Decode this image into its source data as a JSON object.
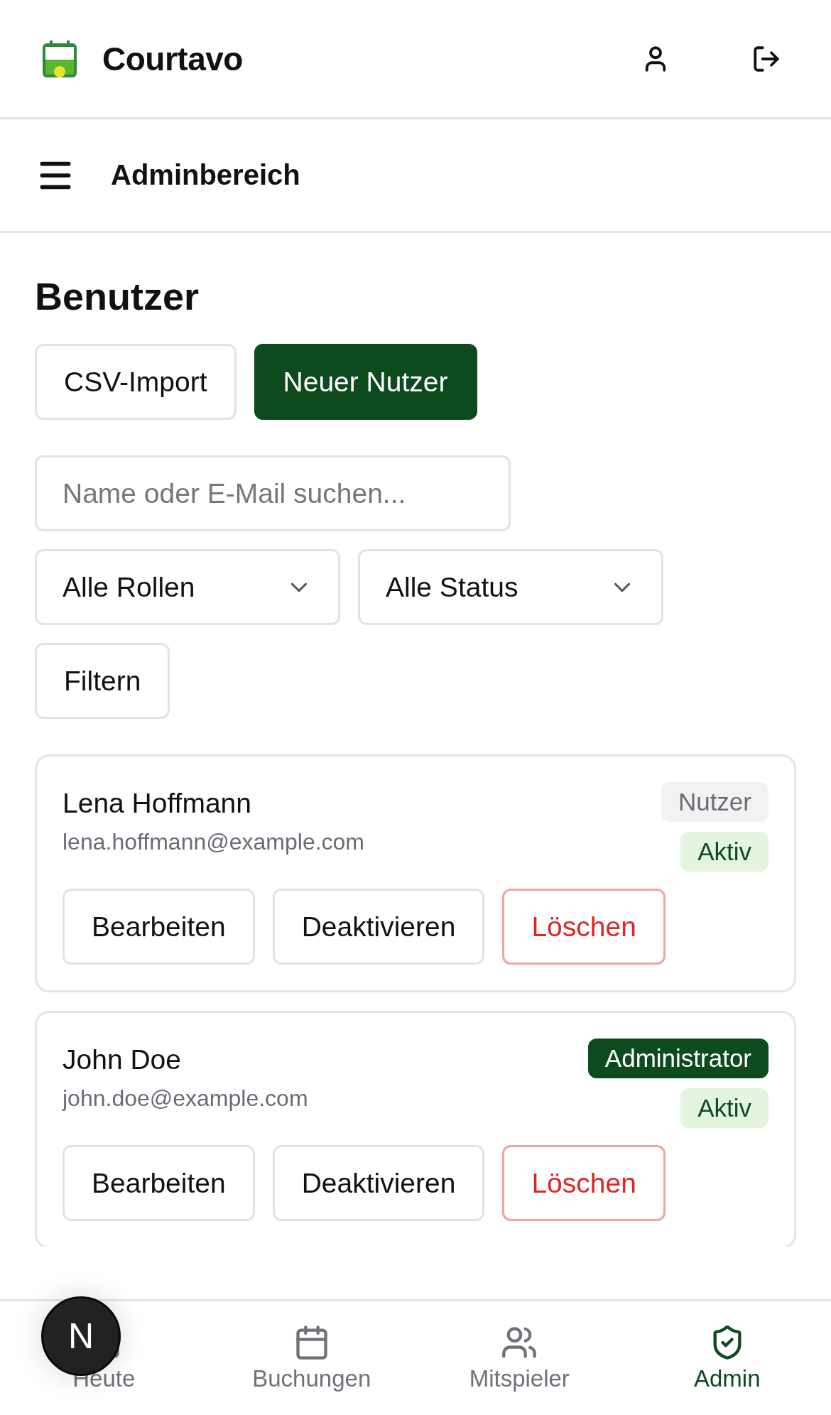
{
  "header": {
    "brand": "Courtavo"
  },
  "subbar": {
    "title": "Adminbereich"
  },
  "page": {
    "title": "Benutzer",
    "actions": [
      {
        "label": "CSV-Import",
        "kind": "secondary"
      },
      {
        "label": "Neuer Nutzer",
        "kind": "primary"
      }
    ],
    "search": {
      "placeholder": "Name oder E-Mail suchen..."
    },
    "filters": [
      {
        "value": "Alle Rollen"
      },
      {
        "value": "Alle Status"
      }
    ],
    "filter_button": "Filtern"
  },
  "users": [
    {
      "name": "Lena Hoffmann",
      "email": "lena.hoffmann@example.com",
      "role": {
        "label": "Nutzer",
        "kind": "user"
      },
      "status": {
        "label": "Aktiv",
        "kind": "active"
      },
      "actions": [
        {
          "label": "Bearbeiten",
          "kind": "normal"
        },
        {
          "label": "Deaktivieren",
          "kind": "normal"
        },
        {
          "label": "Löschen",
          "kind": "danger"
        }
      ]
    },
    {
      "name": "John Doe",
      "email": "john.doe@example.com",
      "role": {
        "label": "Administrator",
        "kind": "admin"
      },
      "status": {
        "label": "Aktiv",
        "kind": "active"
      },
      "actions": [
        {
          "label": "Bearbeiten",
          "kind": "normal"
        },
        {
          "label": "Deaktivieren",
          "kind": "normal"
        },
        {
          "label": "Löschen",
          "kind": "danger"
        }
      ]
    }
  ],
  "bottom_nav": [
    {
      "label": "Heute",
      "selected": false
    },
    {
      "label": "Buchungen",
      "selected": false
    },
    {
      "label": "Mitspieler",
      "selected": false
    },
    {
      "label": "Admin",
      "selected": true
    }
  ],
  "dev_badge": {
    "label": "N"
  }
}
